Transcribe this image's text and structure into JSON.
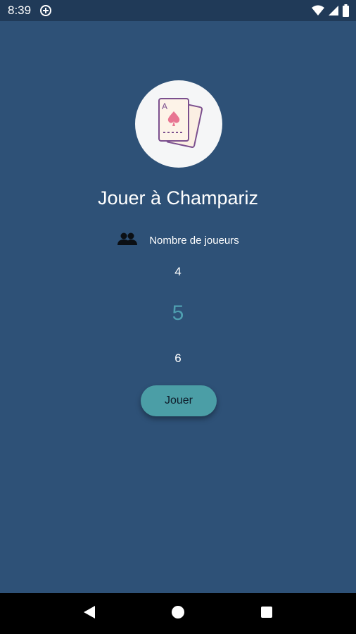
{
  "status_bar": {
    "time": "8:39",
    "icons": [
      "data-saver-icon",
      "wifi-icon",
      "signal-icon",
      "battery-icon"
    ]
  },
  "logo": {
    "icon": "playing-cards-icon",
    "card_letter": "A"
  },
  "title": "Jouer à Champariz",
  "players": {
    "icon": "people-icon",
    "label": "Nombre de joueurs",
    "options": [
      "4",
      "5",
      "6"
    ],
    "selected": "5"
  },
  "play_button": {
    "label": "Jouer"
  },
  "colors": {
    "background": "#2e5177",
    "status_bar": "#203a58",
    "accent": "#4b9ea6",
    "selected_number": "#4f9fb0"
  },
  "nav_bar": {
    "icons": [
      "back-icon",
      "home-icon",
      "recents-icon"
    ]
  }
}
